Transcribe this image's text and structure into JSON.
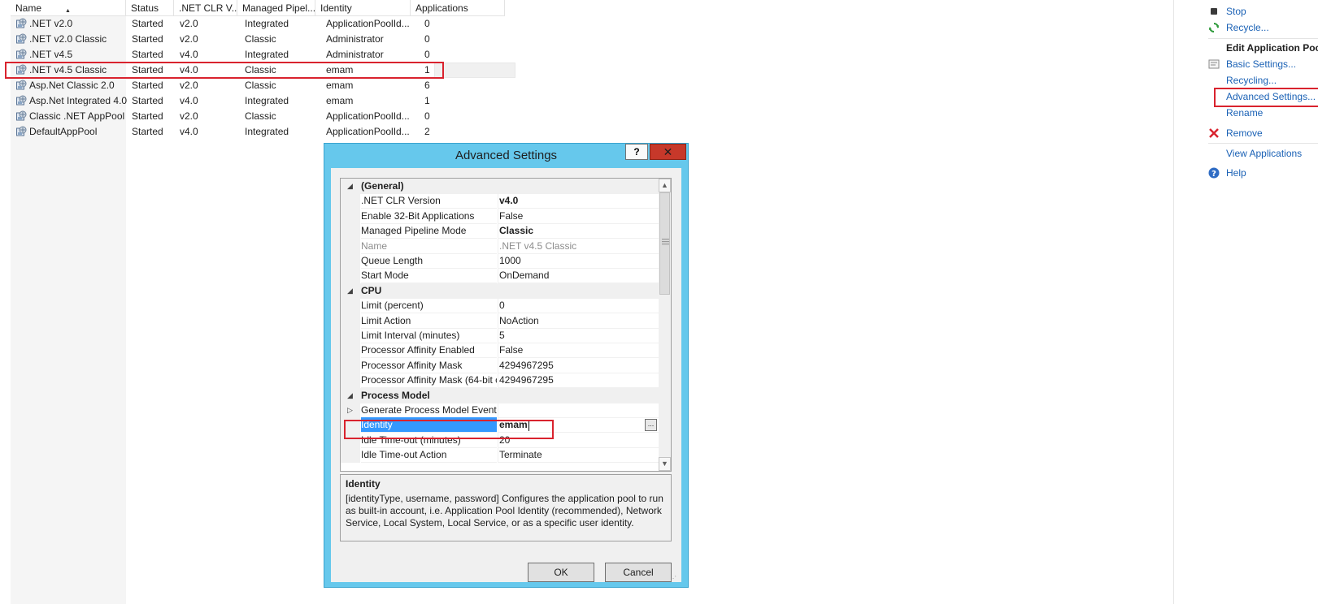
{
  "pool_list": {
    "columns": [
      "Name",
      "Status",
      ".NET CLR V...",
      "Managed Pipel...",
      "Identity",
      "Applications"
    ],
    "rows": [
      {
        "name": ".NET v2.0",
        "status": "Started",
        "clr": "v2.0",
        "pipeline": "Integrated",
        "identity": "ApplicationPoolId...",
        "apps": "0"
      },
      {
        "name": ".NET v2.0 Classic",
        "status": "Started",
        "clr": "v2.0",
        "pipeline": "Classic",
        "identity": "Administrator",
        "apps": "0"
      },
      {
        "name": ".NET v4.5",
        "status": "Started",
        "clr": "v4.0",
        "pipeline": "Integrated",
        "identity": "Administrator",
        "apps": "0"
      },
      {
        "name": ".NET v4.5 Classic",
        "status": "Started",
        "clr": "v4.0",
        "pipeline": "Classic",
        "identity": "emam",
        "apps": "1"
      },
      {
        "name": "Asp.Net Classic 2.0",
        "status": "Started",
        "clr": "v2.0",
        "pipeline": "Classic",
        "identity": "emam",
        "apps": "6"
      },
      {
        "name": "Asp.Net Integrated 4.0",
        "status": "Started",
        "clr": "v4.0",
        "pipeline": "Integrated",
        "identity": "emam",
        "apps": "1"
      },
      {
        "name": "Classic .NET AppPool",
        "status": "Started",
        "clr": "v2.0",
        "pipeline": "Classic",
        "identity": "ApplicationPoolId...",
        "apps": "0"
      },
      {
        "name": "DefaultAppPool",
        "status": "Started",
        "clr": "v4.0",
        "pipeline": "Integrated",
        "identity": "ApplicationPoolId...",
        "apps": "2"
      }
    ]
  },
  "actions": {
    "stop": "Stop",
    "recycle": "Recycle...",
    "edit_heading": "Edit Application Pool",
    "basic_settings": "Basic Settings...",
    "recycling": "Recycling...",
    "advanced_settings": "Advanced Settings...",
    "rename": "Rename",
    "remove": "Remove",
    "view_applications": "View Applications",
    "help": "Help"
  },
  "dialog": {
    "title": "Advanced Settings",
    "help_button": "?",
    "close_button": "✕",
    "categories": {
      "general": "(General)",
      "cpu": "CPU",
      "process_model": "Process Model"
    },
    "general": [
      {
        "name": ".NET CLR Version",
        "value": "v4.0"
      },
      {
        "name": "Enable 32-Bit Applications",
        "value": "False"
      },
      {
        "name": "Managed Pipeline Mode",
        "value": "Classic"
      },
      {
        "name": "Name",
        "value": ".NET v4.5 Classic"
      },
      {
        "name": "Queue Length",
        "value": "1000"
      },
      {
        "name": "Start Mode",
        "value": "OnDemand"
      }
    ],
    "cpu": [
      {
        "name": "Limit (percent)",
        "value": "0"
      },
      {
        "name": "Limit Action",
        "value": "NoAction"
      },
      {
        "name": "Limit Interval (minutes)",
        "value": "5"
      },
      {
        "name": "Processor Affinity Enabled",
        "value": "False"
      },
      {
        "name": "Processor Affinity Mask",
        "value": "4294967295"
      },
      {
        "name": "Processor Affinity Mask (64-bit c",
        "value": "4294967295"
      }
    ],
    "process_model": [
      {
        "name": "Generate Process Model Event L",
        "value": ""
      },
      {
        "name": "Identity",
        "value": "emam"
      },
      {
        "name": "Idle Time-out (minutes)",
        "value": "20"
      },
      {
        "name": "Idle Time-out Action",
        "value": "Terminate"
      }
    ],
    "ellipsis_button": "...",
    "description": {
      "title": "Identity",
      "text": "[identityType, username, password] Configures the application pool to run as built-in account, i.e. Application Pool Identity (recommended), Network Service, Local System, Local Service, or as a specific user identity."
    },
    "ok": "OK",
    "cancel": "Cancel"
  },
  "colors": {
    "highlight_red": "#d9232e",
    "dialog_frame": "#66c8ec",
    "link_blue": "#1a61b5",
    "selection_blue": "#3399ff"
  }
}
